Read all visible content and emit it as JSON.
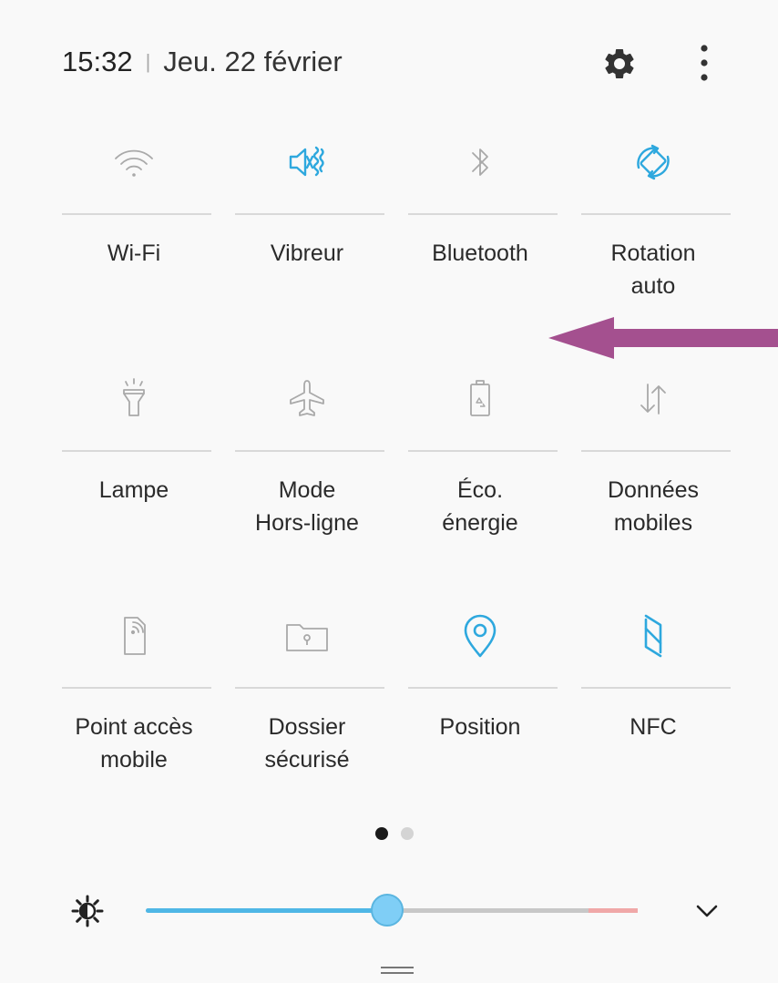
{
  "header": {
    "time": "15:32",
    "separator": "|",
    "date": "Jeu. 22 février",
    "settings_icon": "gear-icon",
    "more_icon": "more-vertical-icon"
  },
  "colors": {
    "accent": "#2ea8de",
    "inactive": "#a9a9a9",
    "annotation_arrow": "#a4508f",
    "slider_fill": "#4fb7e6",
    "slider_warn": "#f0a8a8"
  },
  "tiles": [
    {
      "label": "Wi-Fi",
      "icon": "wifi-icon",
      "active": false
    },
    {
      "label": "Vibreur",
      "icon": "vibrate-icon",
      "active": true
    },
    {
      "label": "Bluetooth",
      "icon": "bluetooth-icon",
      "active": false
    },
    {
      "label": "Rotation\nauto",
      "icon": "auto-rotate-icon",
      "active": true
    },
    {
      "label": "Lampe",
      "icon": "flashlight-icon",
      "active": false
    },
    {
      "label": "Mode\nHors-ligne",
      "icon": "airplane-icon",
      "active": false
    },
    {
      "label": "Éco.\nénergie",
      "icon": "battery-saver-icon",
      "active": false
    },
    {
      "label": "Données\nmobiles",
      "icon": "mobile-data-icon",
      "active": false
    },
    {
      "label": "Point accès\nmobile",
      "icon": "hotspot-icon",
      "active": false
    },
    {
      "label": "Dossier\nsécurisé",
      "icon": "secure-folder-icon",
      "active": false
    },
    {
      "label": "Position",
      "icon": "location-icon",
      "active": true
    },
    {
      "label": "NFC",
      "icon": "nfc-icon",
      "active": true
    }
  ],
  "pager": {
    "pages": 2,
    "current": 1
  },
  "brightness": {
    "icon": "brightness-icon",
    "level": 0.49,
    "warn_start": 0.9,
    "expand_icon": "chevron-down-icon"
  },
  "annotation": {
    "icon": "arrow-left-icon"
  },
  "handle_icon": "drag-handle-icon"
}
